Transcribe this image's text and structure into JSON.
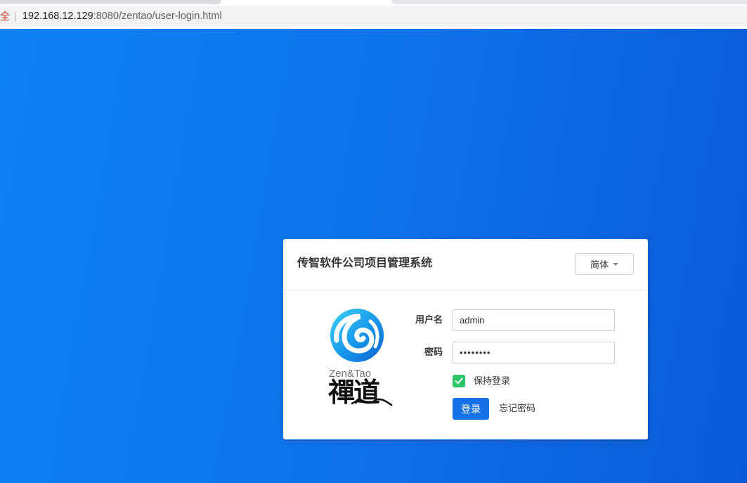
{
  "browser": {
    "security_label": "全",
    "separator": "|",
    "url_host": "192.168.12.129",
    "url_path": ":8080/zentao/user-login.html"
  },
  "login": {
    "title": "传智软件公司项目管理系统",
    "language": "简体",
    "logo": {
      "latin": "Zen&Tao",
      "chinese": "禪道"
    },
    "username": {
      "label": "用户名",
      "value": "admin"
    },
    "password": {
      "label": "密码",
      "value": "••••••••"
    },
    "keep_login": {
      "label": "保持登录",
      "checked": true
    },
    "submit_label": "登录",
    "forgot_label": "忘记密码"
  },
  "icons": {
    "logo": "zentao-logo-icon",
    "language_caret": "caret-down-icon",
    "checkbox_mark": "check-icon"
  },
  "colors": {
    "background_start": "#0f82f5",
    "background_end": "#0b5bd8",
    "accent": "#1671e9",
    "checkbox": "#2fc36a",
    "security_warning": "#d93025"
  }
}
